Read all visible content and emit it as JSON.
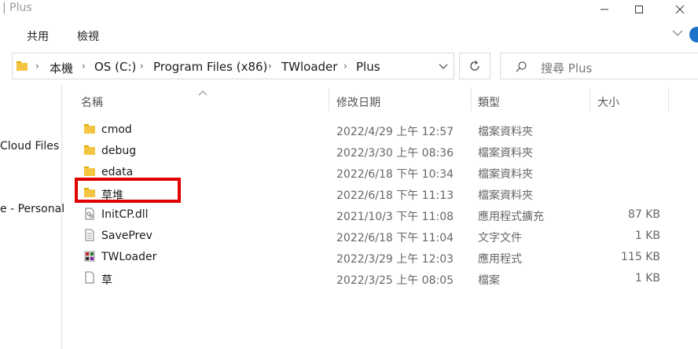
{
  "window": {
    "title": "| Plus"
  },
  "ribbon": {
    "tabs": [
      "共用",
      "檢視"
    ]
  },
  "address": {
    "crumbs": [
      "本機",
      "OS (C:)",
      "Program Files (x86)",
      "TWloader",
      "Plus"
    ],
    "search_placeholder": "搜尋 Plus"
  },
  "nav": {
    "items": [
      "Cloud Files",
      "e - Personal"
    ]
  },
  "columns": {
    "name": "名稱",
    "date": "修改日期",
    "type": "類型",
    "size": "大小"
  },
  "files": [
    {
      "name": "cmod",
      "date": "2022/4/29 上午 12:57",
      "type": "檔案資料夾",
      "size": "",
      "icon": "folder-icon"
    },
    {
      "name": "debug",
      "date": "2022/3/30 上午 08:36",
      "type": "檔案資料夾",
      "size": "",
      "icon": "folder-icon"
    },
    {
      "name": "edata",
      "date": "2022/6/18 下午 10:34",
      "type": "檔案資料夾",
      "size": "",
      "icon": "folder-icon"
    },
    {
      "name": "草堆",
      "date": "2022/6/18 下午 11:13",
      "type": "檔案資料夾",
      "size": "",
      "icon": "folder-icon"
    },
    {
      "name": "InitCP.dll",
      "date": "2021/10/3 下午 11:08",
      "type": "應用程式擴充",
      "size": "87 KB",
      "icon": "dll-file-icon"
    },
    {
      "name": "SavePrev",
      "date": "2022/6/18 下午 11:04",
      "type": "文字文件",
      "size": "1 KB",
      "icon": "text-file-icon"
    },
    {
      "name": "TWLoader",
      "date": "2022/3/29 上午 12:03",
      "type": "應用程式",
      "size": "115 KB",
      "icon": "app-icon"
    },
    {
      "name": "草",
      "date": "2022/3/25 上午 08:05",
      "type": "檔案",
      "size": "1 KB",
      "icon": "blank-file-icon"
    }
  ],
  "colors": {
    "folder": "#f4c542",
    "highlight": "#e00000",
    "accent": "#1a73c8"
  }
}
